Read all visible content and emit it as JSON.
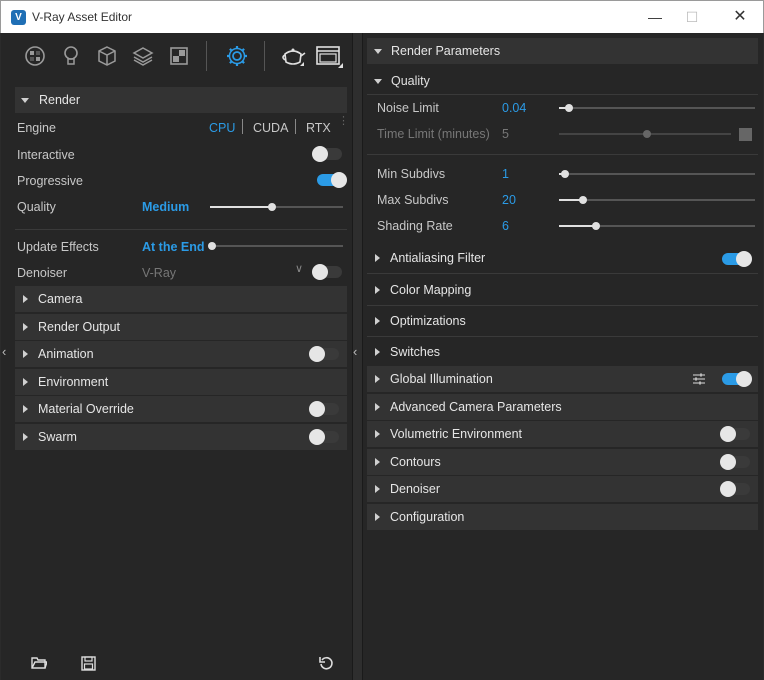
{
  "window": {
    "title": "V-Ray Asset Editor",
    "app_icon": "V",
    "min_label": "—",
    "max_label": "☐",
    "close_label": "✕"
  },
  "toolbar": {
    "icons": [
      "materials-icon",
      "lights-icon",
      "geometry-icon",
      "layers-icon",
      "textures-icon",
      "settings-icon",
      "render-teapot-icon",
      "frame-buffer-icon"
    ],
    "active_icon": "settings-icon"
  },
  "left": {
    "render_header": "Render",
    "engine_label": "Engine",
    "engine_options": [
      "CPU",
      "CUDA",
      "RTX"
    ],
    "engine_selected": "CPU",
    "interactive_label": "Interactive",
    "interactive_on": false,
    "progressive_label": "Progressive",
    "progressive_on": true,
    "quality_label": "Quality",
    "quality_value": "Medium",
    "quality_level": 0.45,
    "update_effects_label": "Update Effects",
    "update_effects_value": "At the End",
    "update_effects_level": 0.0,
    "denoiser_label": "Denoiser",
    "denoiser_value": "V-Ray",
    "denoiser_on": false,
    "sections": [
      {
        "label": "Camera",
        "toggle": null
      },
      {
        "label": "Render Output",
        "toggle": null
      },
      {
        "label": "Animation",
        "toggle": false
      },
      {
        "label": "Environment",
        "toggle": null
      },
      {
        "label": "Material Override",
        "toggle": false
      },
      {
        "label": "Swarm",
        "toggle": false
      }
    ]
  },
  "right": {
    "render_params_header": "Render Parameters",
    "quality_header": "Quality",
    "noise_limit_label": "Noise Limit",
    "noise_limit_value": "0.04",
    "noise_limit_level": 0.04,
    "time_limit_label": "Time Limit (minutes)",
    "time_limit_value": "5",
    "time_limit_level": 0.5,
    "min_subdivs_label": "Min Subdivs",
    "min_subdivs_value": "1",
    "min_subdivs_level": 0.02,
    "max_subdivs_label": "Max Subdivs",
    "max_subdivs_value": "20",
    "max_subdivs_level": 0.11,
    "shading_rate_label": "Shading Rate",
    "shading_rate_value": "6",
    "shading_rate_level": 0.18,
    "sections": [
      {
        "label": "Antialiasing Filter",
        "toggle": true,
        "shaded": false
      },
      {
        "label": "Color Mapping",
        "toggle": null,
        "shaded": false
      },
      {
        "label": "Optimizations",
        "toggle": null,
        "shaded": false
      },
      {
        "label": "Switches",
        "toggle": null,
        "shaded": false
      },
      {
        "label": "Global Illumination",
        "toggle": true,
        "shaded": true,
        "settings": true
      },
      {
        "label": "Advanced Camera Parameters",
        "toggle": null,
        "shaded": true
      },
      {
        "label": "Volumetric Environment",
        "toggle": false,
        "shaded": true
      },
      {
        "label": "Contours",
        "toggle": false,
        "shaded": true
      },
      {
        "label": "Denoiser",
        "toggle": false,
        "shaded": true
      },
      {
        "label": "Configuration",
        "toggle": null,
        "shaded": true
      }
    ]
  },
  "bottom": {
    "icons": [
      "open-folder-icon",
      "save-icon",
      "reset-icon"
    ]
  },
  "colors": {
    "accent": "#2b9be6",
    "panel": "#262626",
    "header": "#333333"
  }
}
